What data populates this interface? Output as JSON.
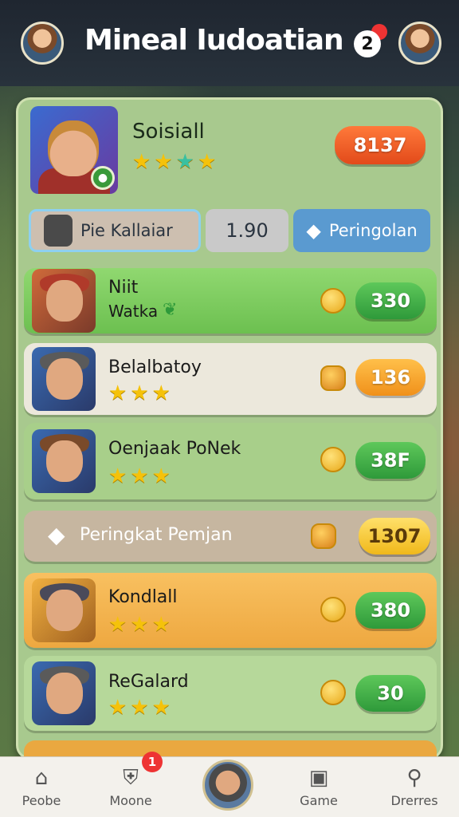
{
  "header": {
    "title": "Mineal Iudoatian",
    "notifications": "2"
  },
  "hero": {
    "name": "Soisiall",
    "stars": 4,
    "score": "8137"
  },
  "tabs": [
    {
      "label": "Pie Kallaiar"
    },
    {
      "label": "1.90"
    },
    {
      "label": "Peringolan"
    }
  ],
  "rows": [
    {
      "name": "Niit",
      "subtitle": "Watka",
      "value": "330",
      "pill": "green"
    },
    {
      "name": "Belalbatoy",
      "stars": 3,
      "value": "136",
      "pill": "orange"
    },
    {
      "name": "Oenjaak PoNek",
      "stars": 3,
      "value": "38F",
      "pill": "green"
    },
    {
      "name": "Peringkat Pemjan",
      "value": "1307",
      "pill": "yellow"
    },
    {
      "name": "Kondlall",
      "stars": 3,
      "value": "380",
      "pill": "green"
    },
    {
      "name": "ReGalard",
      "stars": 3,
      "value": "30",
      "pill": "green"
    }
  ],
  "bottom_nav": [
    {
      "label": "Peobe",
      "icon": "home-icon"
    },
    {
      "label": "Moone",
      "icon": "shield-icon",
      "badge": "1"
    },
    {
      "label": "",
      "icon": "avatar"
    },
    {
      "label": "Game",
      "icon": "game-icon"
    },
    {
      "label": "Drerres",
      "icon": "search-icon"
    }
  ]
}
